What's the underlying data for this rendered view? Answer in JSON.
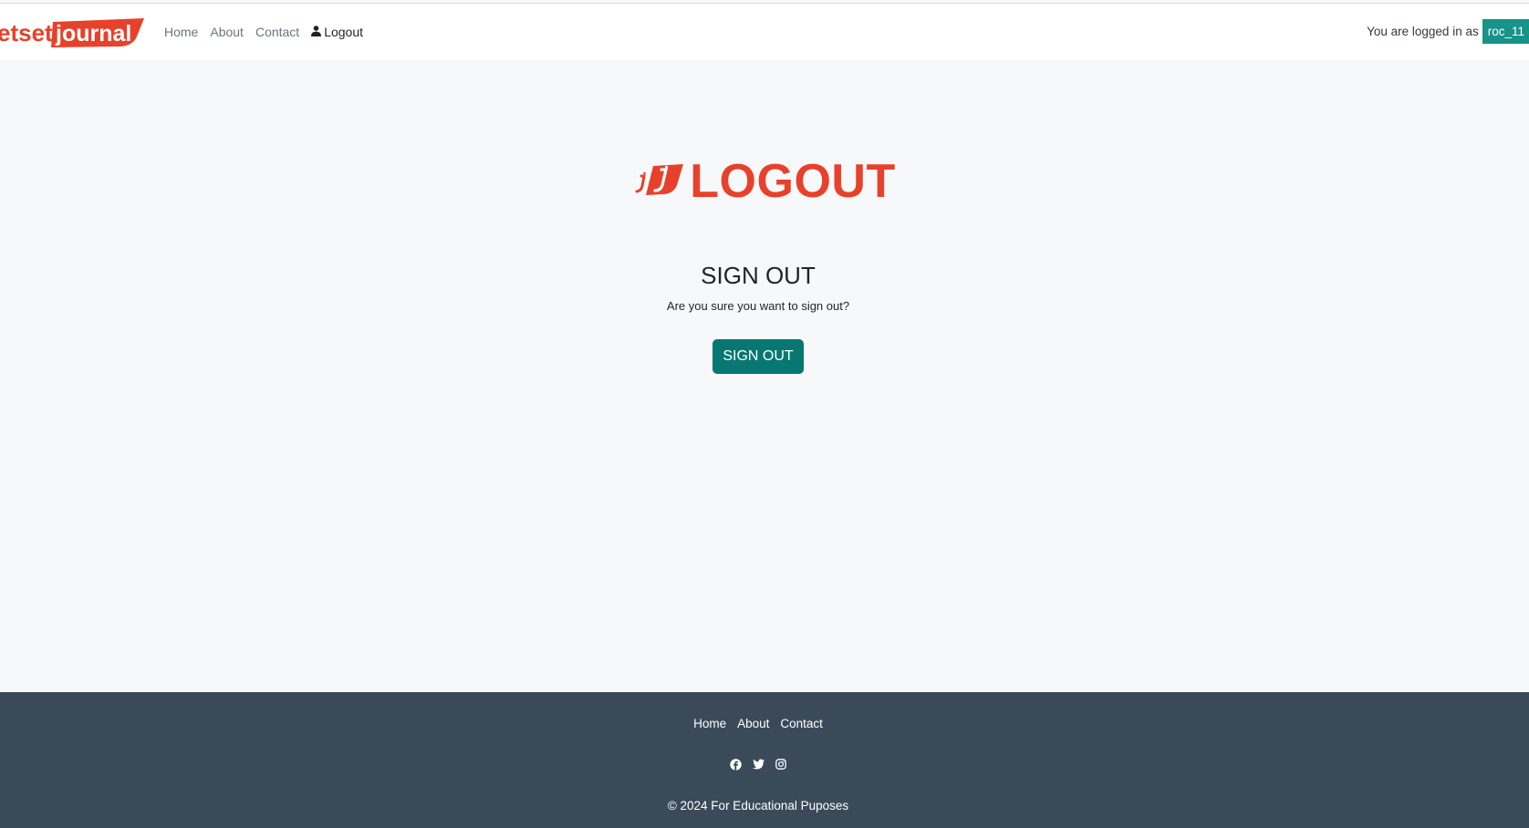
{
  "brand": {
    "logo_text_left": "etset",
    "logo_text_right": "journal",
    "color": "#e8412b"
  },
  "nav": {
    "items": [
      {
        "label": "Home",
        "icon": null
      },
      {
        "label": "About",
        "icon": null
      },
      {
        "label": "Contact",
        "icon": null
      },
      {
        "label": "Logout",
        "icon": "person-icon"
      }
    ]
  },
  "user": {
    "logged_in_text": "You are logged in as",
    "username": "roc_11",
    "badge_color": "#179389"
  },
  "hero": {
    "title": "LOGOUT",
    "color": "#e8412b"
  },
  "signout": {
    "title": "SIGN OUT",
    "question": "Are you sure you want to sign out?",
    "button_label": "SIGN OUT",
    "button_color": "#077772"
  },
  "footer": {
    "links": [
      "Home",
      "About",
      "Contact"
    ],
    "social_icons": [
      "facebook-icon",
      "twitter-icon",
      "instagram-icon"
    ],
    "copyright": "© 2024 For Educational Puposes",
    "background": "#3a4a58"
  }
}
